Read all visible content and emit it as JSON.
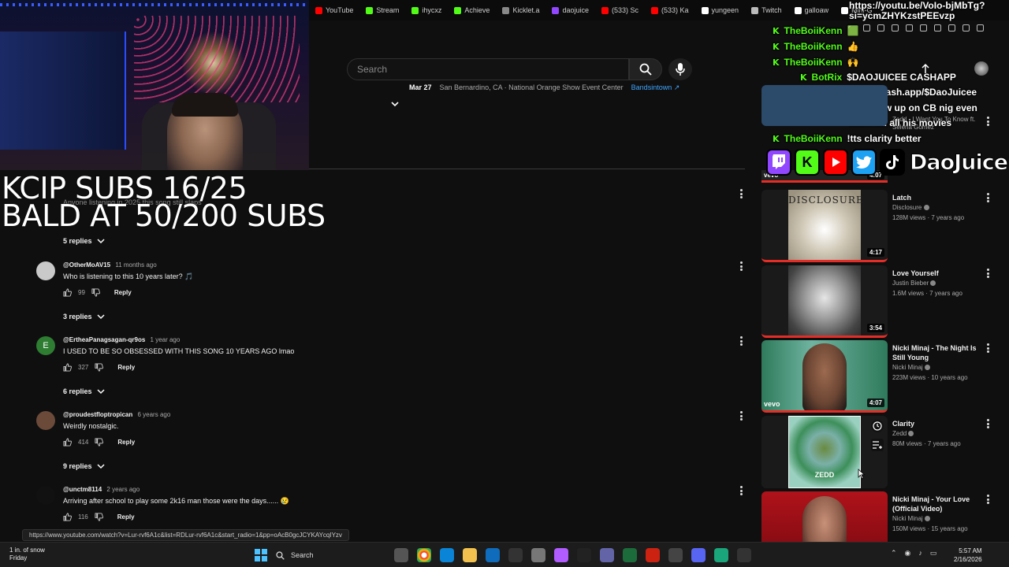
{
  "bookmarks": [
    {
      "label": "YouTube",
      "color": "#ff0000"
    },
    {
      "label": "Stream",
      "color": "#53fc18"
    },
    {
      "label": "ihycxz",
      "color": "#53fc18"
    },
    {
      "label": "Achieve",
      "color": "#53fc18"
    },
    {
      "label": "Kicklet.a",
      "color": "#888888"
    },
    {
      "label": "daojuice",
      "color": "#9146ff"
    },
    {
      "label": "(533) Sc",
      "color": "#ff0000"
    },
    {
      "label": "(533) Ka",
      "color": "#ff0000"
    },
    {
      "label": "yungeen",
      "color": "#ffffff"
    },
    {
      "label": "Twitch",
      "color": "#bbbbbb"
    },
    {
      "label": "galloaw",
      "color": "#ffffff"
    },
    {
      "label": "Mini-G",
      "color": "#ffffff"
    }
  ],
  "stream_overlay": {
    "line1": "KCIP SUBS 16/25",
    "line2": "BALD AT 50/200 SUBS"
  },
  "search": {
    "placeholder": "Search"
  },
  "event": {
    "date": "Mar 27",
    "location": "San Bernardino, CA · National Orange Show Event Center",
    "link": "Bandsintown ↗"
  },
  "partial_comment": {
    "text": "Anyone listening in 2025 this song still slaps",
    "replies": "5 replies"
  },
  "comments": [
    {
      "user": "@OtherMoAV15",
      "time": "11 months ago",
      "text": "Who is listening to this 10 years later? 🎵",
      "likes": "99",
      "reply": "Reply",
      "replies": "3 replies",
      "avatar_color": "#c9c9c9"
    },
    {
      "user": "@ErtheaPanagsagan-qr9os",
      "time": "1 year ago",
      "text": "I USED TO BE SO OBSESSED WITH THIS SONG 10 YEARS AGO lmao",
      "likes": "327",
      "reply": "Reply",
      "replies": "6 replies",
      "avatar_color": "#2e7d32",
      "initial": "E"
    },
    {
      "user": "@proudestfloptropican",
      "time": "6 years ago",
      "text": "Weirdly nostalgic.",
      "likes": "414",
      "reply": "Reply",
      "replies": "9 replies",
      "avatar_color": "#6b4a3a"
    },
    {
      "user": "@unctm8114",
      "time": "2 years ago",
      "text": "Arriving after school to play some 2k16 man those were the days...... 😢",
      "likes": "116",
      "reply": "Reply",
      "replies": "",
      "avatar_color": "#111111"
    }
  ],
  "chat": [
    {
      "user": "",
      "msg": "https://youtu.be/VoIo-bjMbTg?"
    },
    {
      "user": "",
      "msg": "si=ycmZHYKzstPEEvzp"
    },
    {
      "user": "TheBoiiKenn",
      "msg": "🟩"
    },
    {
      "user": "TheBoiiKenn",
      "msg": "👍"
    },
    {
      "user": "TheBoiiKenn",
      "msg": "🙌"
    },
    {
      "user": "BotRix",
      "msg": "$DAOJUICEE CASHAPP"
    },
    {
      "user": "",
      "msg": "https://cash.app/$DaoJuicee"
    },
    {
      "user": "TheBoiiKenn",
      "msg": "!tts I grew up on CB nig even"
    },
    {
      "user": "",
      "msg": "watched all his movies"
    },
    {
      "user": "TheBoiiKenn",
      "msg": "!tts clarity better"
    }
  ],
  "kick_glyph": "K",
  "brand_name": "DaoJuice",
  "partial_video": {
    "title": "Zedd - I Want You To Know ft. Selena Gomez",
    "duration": "4:07"
  },
  "videos": [
    {
      "title": "Latch",
      "channel": "Disclosure",
      "meta": "128M views · 7 years ago",
      "duration": "4:17",
      "thumb_text": "DISCLOSURE",
      "thumb_bg": "#d8d2c4"
    },
    {
      "title": "Love Yourself",
      "channel": "Justin Bieber",
      "meta": "1.6M views · 7 years ago",
      "duration": "3:54",
      "thumb_text": "",
      "thumb_bg": "#3a3a3a"
    },
    {
      "title": "Nicki Minaj - The Night Is Still Young",
      "channel": "Nicki Minaj",
      "meta": "223M views · 10 years ago",
      "duration": "4:07",
      "thumb_text": "vevo",
      "thumb_bg": "#3f8f6f"
    },
    {
      "title": "Clarity",
      "channel": "Zedd",
      "meta": "80M views · 7 years ago",
      "duration": "",
      "thumb_text": "ZEDD",
      "thumb_bg": "#3a3a3a"
    },
    {
      "title": "Nicki Minaj - Your Love (Official Video)",
      "channel": "Nicki Minaj",
      "meta": "150M views · 15 years ago",
      "duration": "",
      "thumb_text": "",
      "thumb_bg": "#b0121a"
    }
  ],
  "status_url": "https://www.youtube.com/watch?v=Lur-rvf6A1c&list=RDLur-rvf6A1c&start_radio=1&pp=oAcB0gcJCYKAYcqIYzv",
  "taskbar": {
    "weather_line1": "1 in. of snow",
    "weather_line2": "Friday",
    "search": "Search",
    "time": "5:57 AM",
    "date": "2/16/2026"
  }
}
